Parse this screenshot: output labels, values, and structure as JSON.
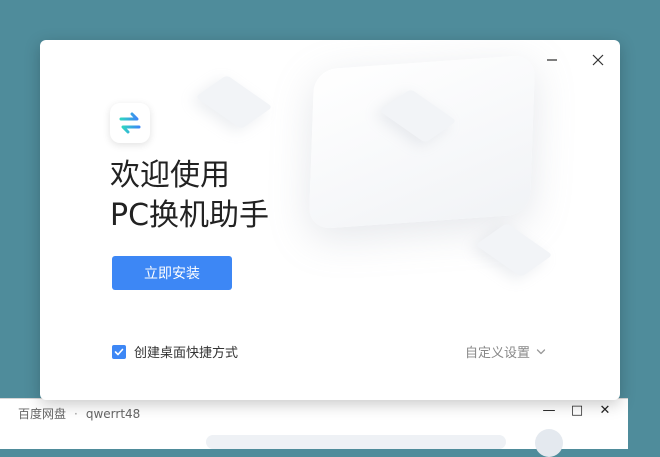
{
  "dialog": {
    "title_line1": "欢迎使用",
    "title_line2": "PC换机助手",
    "install_button": "立即安装",
    "shortcut_checkbox": {
      "label": "创建桌面快捷方式",
      "checked": true
    },
    "custom_settings": "自定义设置",
    "icons": {
      "minimize": "minimize-icon",
      "close": "close-icon",
      "logo": "swap-arrows-icon",
      "dropdown": "chevron-down-icon"
    },
    "colors": {
      "accent": "#3d87f5",
      "logo_gradient": [
        "#2fd3c2",
        "#3d87f5"
      ]
    }
  },
  "background_window": {
    "app": "百度网盘",
    "separator": "·",
    "user": "qwerrt48"
  }
}
